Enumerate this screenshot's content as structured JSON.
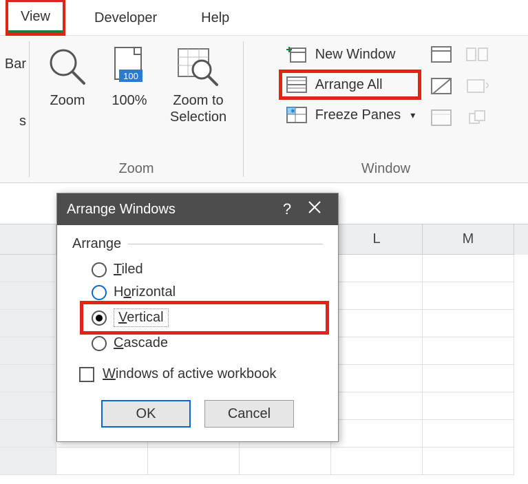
{
  "tabs": {
    "view": "View",
    "developer": "Developer",
    "help": "Help"
  },
  "leftcut": {
    "bar": "Bar",
    "s": "s"
  },
  "zoom": {
    "group": "Zoom",
    "zoom": "Zoom",
    "pct100": "100%",
    "zoom_sel_l1": "Zoom to",
    "zoom_sel_l2": "Selection"
  },
  "window": {
    "group": "Window",
    "new_window": "New Window",
    "arrange_all": "Arrange All",
    "freeze_panes": "Freeze Panes"
  },
  "columns": [
    "",
    "",
    "",
    "L",
    "M"
  ],
  "dialog": {
    "title": "Arrange Windows",
    "help": "?",
    "arrange": "Arrange",
    "tiled_pre": "T",
    "tiled_post": "iled",
    "horiz_pre": "H",
    "horiz_post": "orizontal",
    "vert_pre": "V",
    "vert_post": "ertical",
    "casc_pre": "C",
    "casc_post": "ascade",
    "win_pre": "W",
    "win_post": "indows of active workbook",
    "ok": "OK",
    "cancel": "Cancel"
  }
}
